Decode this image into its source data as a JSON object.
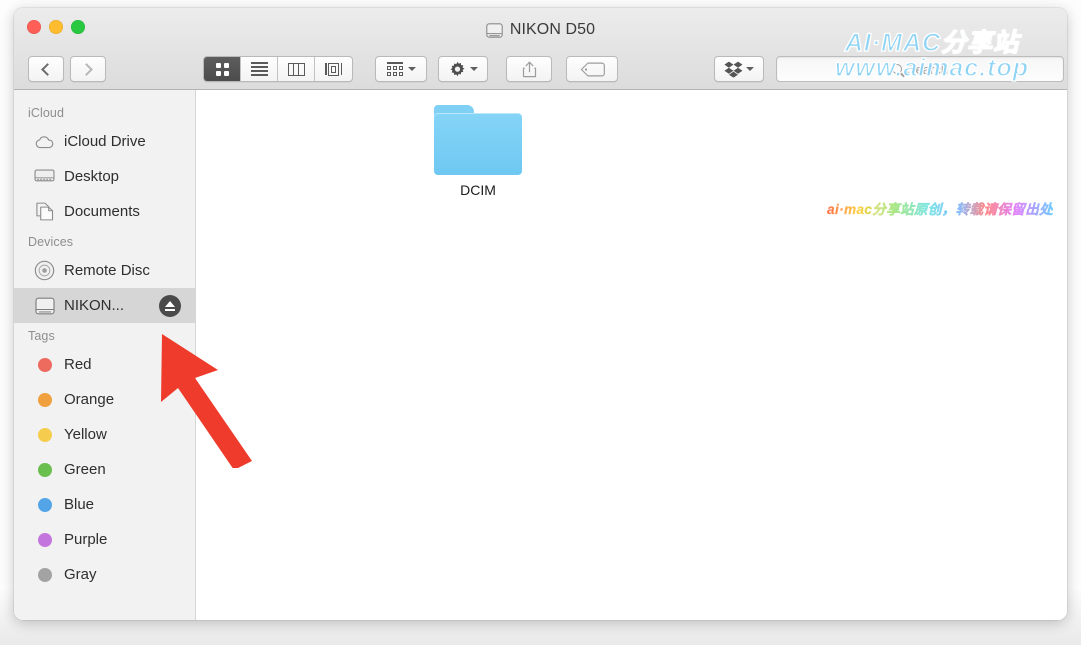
{
  "window": {
    "title": "NIKON D50",
    "title_icon": "external-drive-icon",
    "traffic_lights": {
      "close": "close-button",
      "minimize": "minimize-button",
      "zoom": "zoom-button"
    }
  },
  "toolbar": {
    "back_label": "Back",
    "forward_label": "Forward",
    "view_modes": [
      {
        "name": "icon-view",
        "label": "Icon View",
        "active": true
      },
      {
        "name": "list-view",
        "label": "List View",
        "active": false
      },
      {
        "name": "column-view",
        "label": "Column View",
        "active": false
      },
      {
        "name": "gallery-view",
        "label": "Gallery View",
        "active": false
      }
    ],
    "arrange_label": "Arrange By",
    "action_label": "Action",
    "share_label": "Share",
    "tag_label": "Edit Tags",
    "dropbox_label": "Dropbox"
  },
  "search": {
    "placeholder": "Search",
    "value": ""
  },
  "sidebar": {
    "sections": [
      {
        "title": "iCloud",
        "items": [
          {
            "label": "iCloud Drive",
            "icon": "cloud-icon",
            "selected": false
          },
          {
            "label": "Desktop",
            "icon": "desktop-icon",
            "selected": false
          },
          {
            "label": "Documents",
            "icon": "documents-icon",
            "selected": false
          }
        ]
      },
      {
        "title": "Devices",
        "items": [
          {
            "label": "Remote Disc",
            "icon": "disc-icon",
            "selected": false
          },
          {
            "label": "NIKON...",
            "icon": "external-drive-icon",
            "selected": true,
            "eject": true
          }
        ]
      },
      {
        "title": "Tags",
        "items": [
          {
            "label": "Red",
            "icon": "tag-dot",
            "color": "#ec6a5e",
            "selected": false
          },
          {
            "label": "Orange",
            "icon": "tag-dot",
            "color": "#f0a03c",
            "selected": false
          },
          {
            "label": "Yellow",
            "icon": "tag-dot",
            "color": "#f5cc4d",
            "selected": false
          },
          {
            "label": "Green",
            "icon": "tag-dot",
            "color": "#6bbf4e",
            "selected": false
          },
          {
            "label": "Blue",
            "icon": "tag-dot",
            "color": "#54a5e8",
            "selected": false
          },
          {
            "label": "Purple",
            "icon": "tag-dot",
            "color": "#c377de",
            "selected": false
          },
          {
            "label": "Gray",
            "icon": "tag-dot",
            "color": "#a3a3a3",
            "selected": false
          }
        ]
      }
    ]
  },
  "content": {
    "files": [
      {
        "name": "DCIM",
        "type": "folder",
        "color": "#6ec8f2"
      }
    ]
  },
  "watermarks": {
    "top_line1": "AI·MAC分享站",
    "top_line2": "www.aimac.top",
    "rainbow": "ai·mac分享站原创，转载请保留出处"
  },
  "annotation": {
    "arrow": "red-arrow-pointing-to-eject-button",
    "color": "#ee3b2b"
  }
}
